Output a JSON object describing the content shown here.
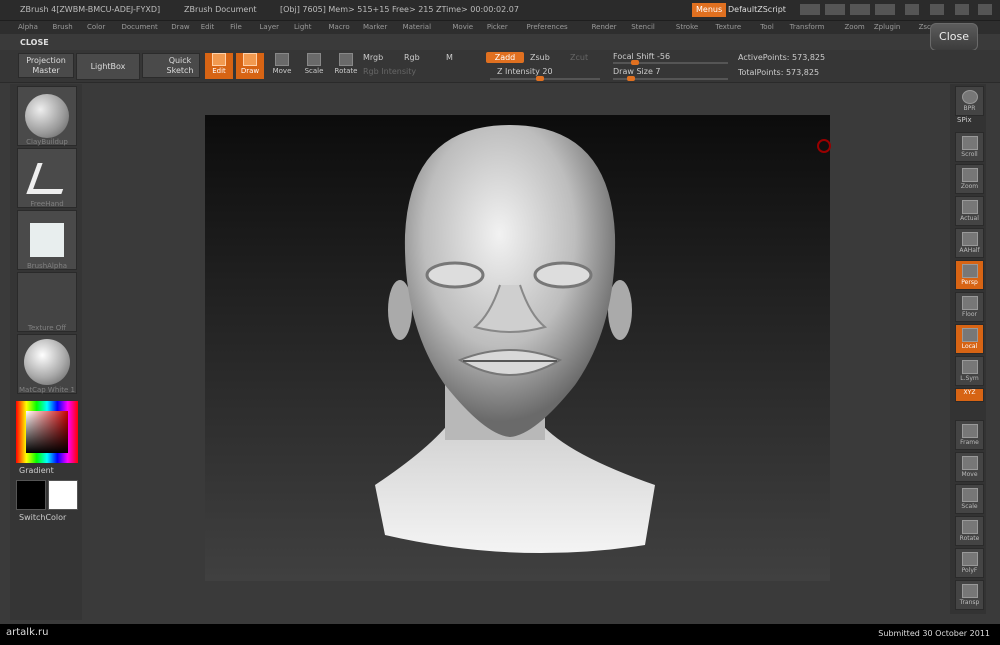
{
  "titlebar": {
    "app": "ZBrush 4[ZWBM-BMCU-ADEJ-FYXD]",
    "doc": "ZBrush Document",
    "stats": "[Obj] 7605] Mem> 515+15 Free> 215 ZTime> 00:00:02.07",
    "menus_button": "Menus",
    "zscript_button": "DefaultZScript"
  },
  "menubar": [
    "Alpha",
    "Brush",
    "Color",
    "Document",
    "Draw",
    "Edit",
    "File",
    "Layer",
    "Light",
    "Macro",
    "Marker",
    "Material",
    "Movie",
    "Picker",
    "Preferences",
    "Render",
    "Stencil",
    "Stroke",
    "Texture",
    "Tool",
    "Transform",
    "Zoom",
    "Zplugin",
    "Zscript"
  ],
  "close_label": "CLOSE",
  "close_button": "Close",
  "toolbar": {
    "projection_master": "Projection Master",
    "lightbox": "LightBox",
    "quick_sketch": "Quick Sketch",
    "tools": [
      {
        "label": "Edit",
        "active": true
      },
      {
        "label": "Draw",
        "active": true
      },
      {
        "label": "Move",
        "active": false
      },
      {
        "label": "Scale",
        "active": false
      },
      {
        "label": "Rotate",
        "active": false
      }
    ],
    "mrgb": "Mrgb",
    "rgb": "Rgb",
    "m": "M",
    "rgb_intensity": "Rgb Intensity",
    "zadd": "Zadd",
    "zsub": "Zsub",
    "zcut": "Zcut",
    "z_intensity": "Z Intensity 20",
    "focal_shift": "Focal Shift -56",
    "draw_size": "Draw Size 7",
    "active_points": "ActivePoints: 573,825",
    "total_points": "TotalPoints: 573,825"
  },
  "left_panel": {
    "brush": "ClayBuildup",
    "stroke": "FreeHand",
    "alpha": "BrushAlpha",
    "texture": "Texture Off",
    "material": "MatCap White 1",
    "gradient": "Gradient",
    "switch_color": "SwitchColor"
  },
  "right_panel": {
    "bpr": "BPR",
    "spix": "SPix",
    "buttons": [
      {
        "label": "Scroll",
        "active": false
      },
      {
        "label": "Zoom",
        "active": false
      },
      {
        "label": "Actual",
        "active": false
      },
      {
        "label": "AAHalf",
        "active": false
      },
      {
        "label": "Persp",
        "active": true
      },
      {
        "label": "Floor",
        "active": false
      },
      {
        "label": "Local",
        "active": true
      },
      {
        "label": "L.Sym",
        "active": false
      },
      {
        "label": "XYZ",
        "active": true
      },
      {
        "label": "Frame",
        "active": false
      },
      {
        "label": "Move",
        "active": false
      },
      {
        "label": "Scale",
        "active": false
      },
      {
        "label": "Rotate",
        "active": false
      },
      {
        "label": "PolyF",
        "active": false
      },
      {
        "label": "Transp",
        "active": false
      }
    ]
  },
  "footer": {
    "site": "artalk.ru",
    "submitted": "Submitted 30 October 2011"
  },
  "colors": {
    "accent": "#e07020",
    "bg": "#3a3a3a"
  }
}
